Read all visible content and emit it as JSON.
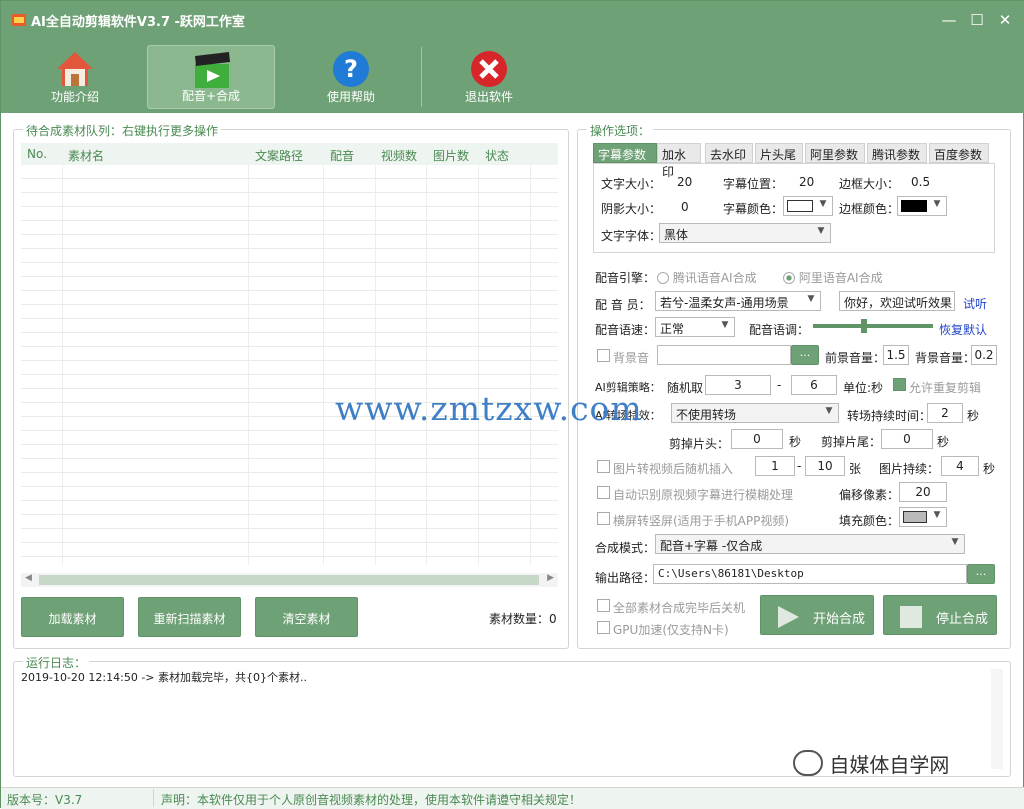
{
  "app": {
    "title": "AI全自动剪辑软件V3.7 -跃网工作室"
  },
  "toolbar": [
    {
      "label": "功能介绍",
      "icon": "home-icon"
    },
    {
      "label": "配音+合成",
      "icon": "clapper-icon"
    },
    {
      "label": "使用帮助",
      "icon": "help-icon"
    },
    {
      "label": "退出软件",
      "icon": "exit-icon"
    }
  ],
  "queue": {
    "title": "待合成素材队列：右键执行更多操作",
    "columns": [
      "No.",
      "素材名",
      "文案路径",
      "配音",
      "视频数",
      "图片数",
      "状态"
    ],
    "load_btn": "加载素材",
    "rescan_btn": "重新扫描素材",
    "clear_btn": "清空素材",
    "count_label": "素材数量：0"
  },
  "options": {
    "title": "操作选项：",
    "tabs": [
      "字幕参数",
      "加水印",
      "去水印",
      "片头尾",
      "阿里参数",
      "腾讯参数",
      "百度参数"
    ],
    "font_size_label": "文字大小：",
    "font_size": "20",
    "sub_pos_label": "字幕位置：",
    "sub_pos": "20",
    "border_size_label": "边框大小：",
    "border_size": "0.5",
    "shadow_label": "阴影大小：",
    "shadow": "0",
    "sub_color_label": "字幕颜色：",
    "border_color_label": "边框颜色：",
    "font_label": "文字字体：",
    "font": "黑体",
    "engine_label": "配音引擎：",
    "engine_tx": "腾讯语音AI合成",
    "engine_ali": "阿里语音AI合成",
    "voicer_label": "配 音 员：",
    "voicer": "若兮-温柔女声-通用场景",
    "preview_text": "你好，欢迎试听效果",
    "try_link": "试听",
    "speed_label": "配音语速：",
    "speed": "正常",
    "pitch_label": "配音语调：",
    "reset_link": "恢复默认",
    "bgm_label": "背景音",
    "bgm_browse": "...",
    "front_vol_label": "前景音量：",
    "front_vol": "1.5",
    "bg_vol_label": "背景音量：",
    "bg_vol": "0.2",
    "ai_label": "AI剪辑策略：",
    "rand_label": "随机取：",
    "rand_min": "3",
    "dash": "-",
    "rand_max": "6",
    "unit_label": "单位:秒",
    "allow_repeat": "允许重复剪辑",
    "trans_label": "AI转场特效：",
    "trans": "不使用转场",
    "trans_dur_label": "转场持续时间：",
    "trans_dur": "2",
    "sec": "秒",
    "cut_head_label": "剪掉片头：",
    "cut_head": "0",
    "cut_tail_label": "剪掉片尾：",
    "cut_tail": "0",
    "img_insert_label": "图片转视频后随机插入",
    "img_min": "1",
    "img_max": "10",
    "zhang": "张",
    "img_dur_label": "图片持续：",
    "img_dur": "4",
    "blur_label": "自动识别原视频字幕进行模糊处理",
    "offset_label": "偏移像素：",
    "offset": "20",
    "portrait_label": "横屏转竖屏(适用于手机APP视频)",
    "fill_label": "填充颜色：",
    "mode_label": "合成模式：",
    "mode": "配音+字幕 -仅合成",
    "out_label": "输出路径：",
    "out_path": "C:\\Users\\86181\\Desktop",
    "out_browse": "...",
    "shutdown_label": "全部素材合成完毕后关机",
    "gpu_label": "GPU加速(仅支持N卡)",
    "start_btn": "开始合成",
    "stop_btn": "停止合成"
  },
  "log": {
    "title": "运行日志：",
    "line": "2019-10-20 12:14:50 -> 素材加载完毕，共{0}个素材.."
  },
  "status": {
    "version": "版本号：V3.7",
    "notice": "声明：本软件仅用于个人原创音视频素材的处理，使用本软件请遵守相关规定！"
  },
  "watermarks": {
    "url": "www.zmtzxw.com",
    "brand": "自媒体自学网"
  },
  "colors": {
    "accent": "#6fa176",
    "link": "#2244cc"
  }
}
